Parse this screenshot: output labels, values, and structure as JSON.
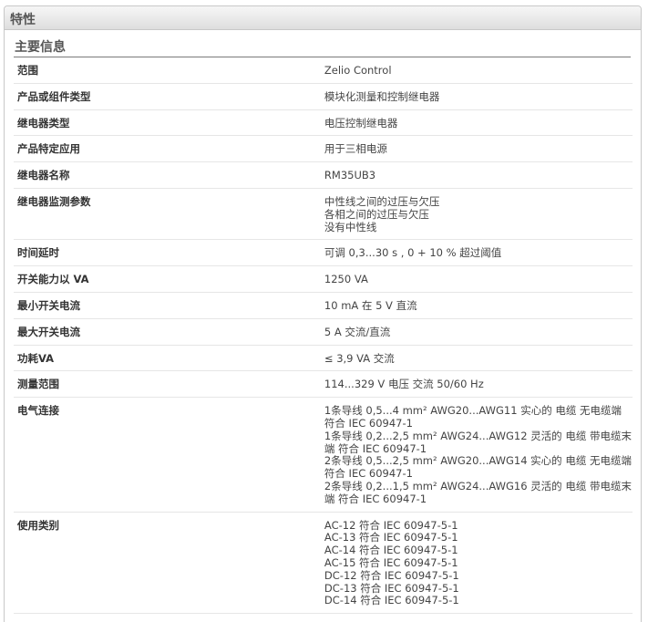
{
  "header": {
    "title": "特性"
  },
  "section": {
    "title": "主要信息"
  },
  "rows": [
    {
      "label": "范围",
      "values": [
        "Zelio Control"
      ]
    },
    {
      "label": "产品或组件类型",
      "values": [
        "模块化测量和控制继电器"
      ]
    },
    {
      "label": "继电器类型",
      "values": [
        "电压控制继电器"
      ]
    },
    {
      "label": "产品特定应用",
      "values": [
        "用于三相电源"
      ]
    },
    {
      "label": "继电器名称",
      "values": [
        "RM35UB3"
      ]
    },
    {
      "label": "继电器监测参数",
      "values": [
        "中性线之间的过压与欠压",
        "各相之间的过压与欠压",
        "没有中性线"
      ]
    },
    {
      "label": "时间延时",
      "values": [
        "可调 0,3...30 s , 0 + 10 % 超过阈值"
      ]
    },
    {
      "label": "开关能力以 VA",
      "values": [
        "1250 VA"
      ]
    },
    {
      "label": "最小开关电流",
      "values": [
        "10 mA 在 5 V 直流"
      ]
    },
    {
      "label": "最大开关电流",
      "values": [
        "5 A 交流/直流"
      ]
    },
    {
      "label": "功耗VA",
      "values": [
        "≤ 3,9 VA 交流"
      ]
    },
    {
      "label": "测量范围",
      "values": [
        "114...329 V 电压 交流 50/60 Hz"
      ]
    },
    {
      "label": "电气连接",
      "values": [
        "1条导线 0,5...4 mm² AWG20...AWG11 实心的 电缆 无电缆端",
        "符合 IEC 60947-1",
        "1条导线 0,2...2,5 mm² AWG24...AWG12 灵活的 电缆 带电缆末",
        "端 符合 IEC 60947-1",
        "2条导线 0,5...2,5 mm² AWG20...AWG14 实心的 电缆 无电缆端",
        "符合 IEC 60947-1",
        "2条导线 0,2...1,5 mm² AWG24...AWG16 灵活的 电缆 带电缆末",
        "端 符合 IEC 60947-1"
      ]
    },
    {
      "label": "使用类别",
      "values": [
        "AC-12 符合 IEC 60947-5-1",
        "AC-13 符合 IEC 60947-5-1",
        "AC-14 符合 IEC 60947-5-1",
        "AC-15 符合 IEC 60947-5-1",
        "DC-12 符合 IEC 60947-5-1",
        "DC-13 符合 IEC 60947-5-1",
        "DC-14 符合 IEC 60947-5-1"
      ]
    }
  ]
}
